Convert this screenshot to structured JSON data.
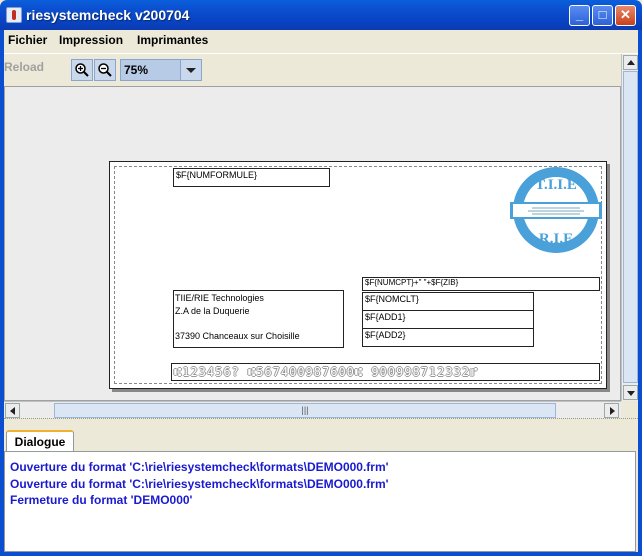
{
  "window": {
    "title": "riesystemcheck v200704"
  },
  "menu": {
    "items": [
      "Fichier",
      "Impression",
      "Imprimantes"
    ]
  },
  "toolbar": {
    "reload_label": "Reload",
    "zoom_value": "75%"
  },
  "document": {
    "fields": {
      "numformule": "$F{NUMFORMULE}",
      "numcpt": "$F{NUMCPT}+\" \"+$F{ZIB}",
      "nomclt": "$F{NOMCLT}",
      "add1": "$F{ADD1}",
      "add2": "$F{ADD2}"
    },
    "sender": [
      "TIIE/RIE Technologies",
      "Z.A de la Duquerie",
      "",
      "37390 Chanceaux sur Choisille"
    ],
    "micr_line": "⑆123456?  ⑆567400987600⑆  900998712332⑈",
    "logo": {
      "top_text": "T.I.I.E",
      "bottom_text": "R.I.E"
    }
  },
  "console": {
    "tab_label": "Dialogue",
    "messages": [
      "Ouverture du format 'C:\\rie\\riesystemcheck\\formats\\DEMO000.frm'",
      "Ouverture du format 'C:\\rie\\riesystemcheck\\formats\\DEMO000.frm'",
      "Fermeture du format 'DEMO000'"
    ]
  },
  "colors": {
    "titlebar": "#0b4fd0",
    "message_text": "#1a1ad0",
    "logo_blue": "#4aa0d8"
  }
}
